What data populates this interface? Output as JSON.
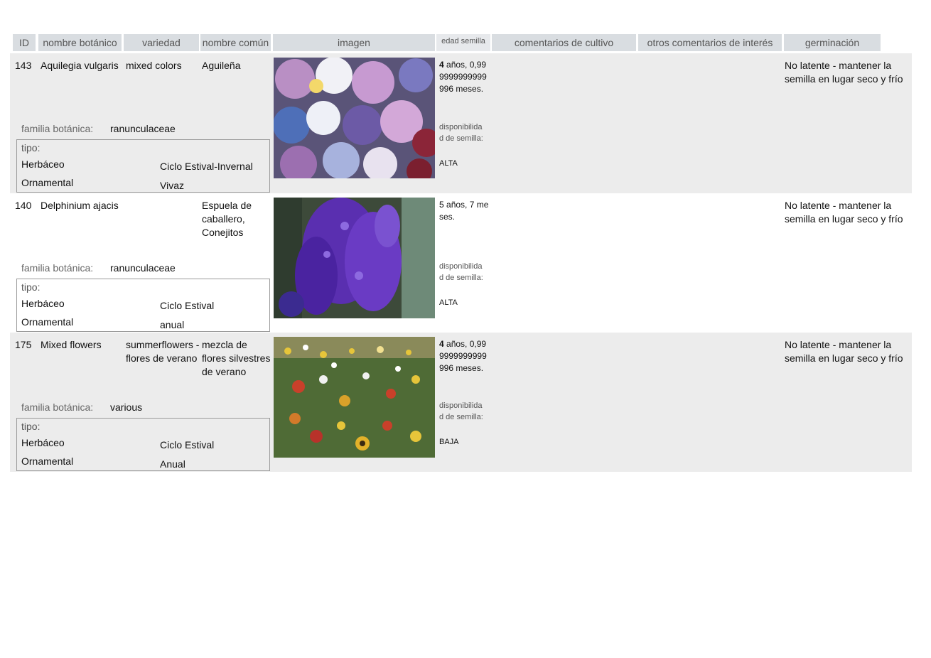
{
  "headers": {
    "id": "ID",
    "nombre_botanico": "nombre botánico",
    "variedad": "variedad",
    "nombre_comun": "nombre común",
    "imagen": "imagen",
    "edad_semilla": "edad semilla",
    "comentarios_cultivo": "comentarios de cultivo",
    "otros_comentarios": "otros comentarios de interés",
    "germinacion": "germinación"
  },
  "labels": {
    "familia": "familia botánica:",
    "tipo": "tipo:",
    "disponibilidad": "disponibilidad de semilla:"
  },
  "rows": [
    {
      "id": "143",
      "nombre_botanico": "Aquilegia vulgaris",
      "variedad": "mixed colors",
      "nombre_comun": "Aguileña",
      "familia": "ranunculaceae",
      "tipo": [
        "Herbáceo",
        "Ciclo Estival-Invernal",
        "Ornamental",
        "Vivaz"
      ],
      "edad_num": "4",
      "edad_text": " años, 0,999999999999996 meses.",
      "disponibilidad": "ALTA",
      "germinacion": "No latente - mantener la semilla en lugar seco y frío",
      "image_icon": "columbine-flowers-photo"
    },
    {
      "id": "140",
      "nombre_botanico": "Delphinium ajacis",
      "variedad": "",
      "nombre_comun": "Espuela de caballero, Conejitos",
      "familia": "ranunculaceae",
      "tipo": [
        "Herbáceo",
        "Ciclo Estival",
        "Ornamental",
        "anual"
      ],
      "edad_num": "5",
      "edad_text": " años, 7 meses.",
      "disponibilidad": "ALTA",
      "germinacion": "No latente - mantener la semilla en lugar seco y frío",
      "image_icon": "larkspur-flowers-photo"
    },
    {
      "id": "175",
      "nombre_botanico": "Mixed flowers",
      "variedad": "summerflowers -flores de verano",
      "nombre_comun": "mezcla de flores silvestres de verano",
      "familia": "various",
      "tipo": [
        "Herbáceo",
        "Ciclo Estival",
        "Ornamental",
        "Anual"
      ],
      "edad_num": "4",
      "edad_text": " años, 0,999999999999996 meses.",
      "disponibilidad": "BAJA",
      "germinacion": "No latente - mantener la semilla en lugar seco y frío",
      "image_icon": "wildflower-meadow-photo"
    }
  ]
}
